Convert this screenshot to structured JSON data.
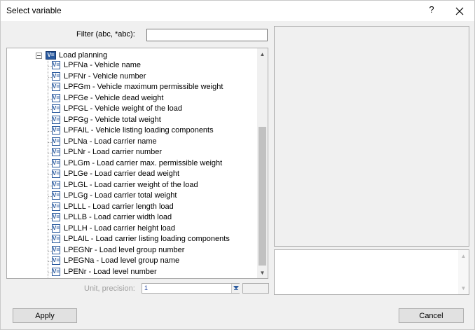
{
  "window": {
    "title": "Select variable",
    "help_label": "?"
  },
  "filter": {
    "label": "Filter (abc, *abc):",
    "value": ""
  },
  "tree": {
    "root_label": "Load planning",
    "root_icon": "V=",
    "item_icon": "V=",
    "items": [
      "LPFNa - Vehicle name",
      "LPFNr - Vehicle number",
      "LPFGm - Vehicle maximum permissible weight",
      "LPFGe - Vehicle dead weight",
      "LPFGL - Vehicle weight of the load",
      "LPFGg - Vehicle total weight",
      "LPFAIL - Vehicle listing loading components",
      "LPLNa - Load carrier name",
      "LPLNr - Load carrier number",
      "LPLGm - Load carrier max. permissible weight",
      "LPLGe - Load carrier dead weight",
      "LPLGL - Load carrier weight of the load",
      "LPLGg - Load carrier total weight",
      "LPLLL - Load carrier length load",
      "LPLLB - Load carrier width load",
      "LPLLH - Load carrier height load",
      "LPLAIL - Load carrier listing loading components",
      "LPEGNr - Load level group number",
      "LPEGNa - Load level group name",
      "LPENr - Load level number"
    ]
  },
  "unit": {
    "label": "Unit, precision:",
    "value": "1"
  },
  "buttons": {
    "apply": "Apply",
    "cancel": "Cancel"
  }
}
